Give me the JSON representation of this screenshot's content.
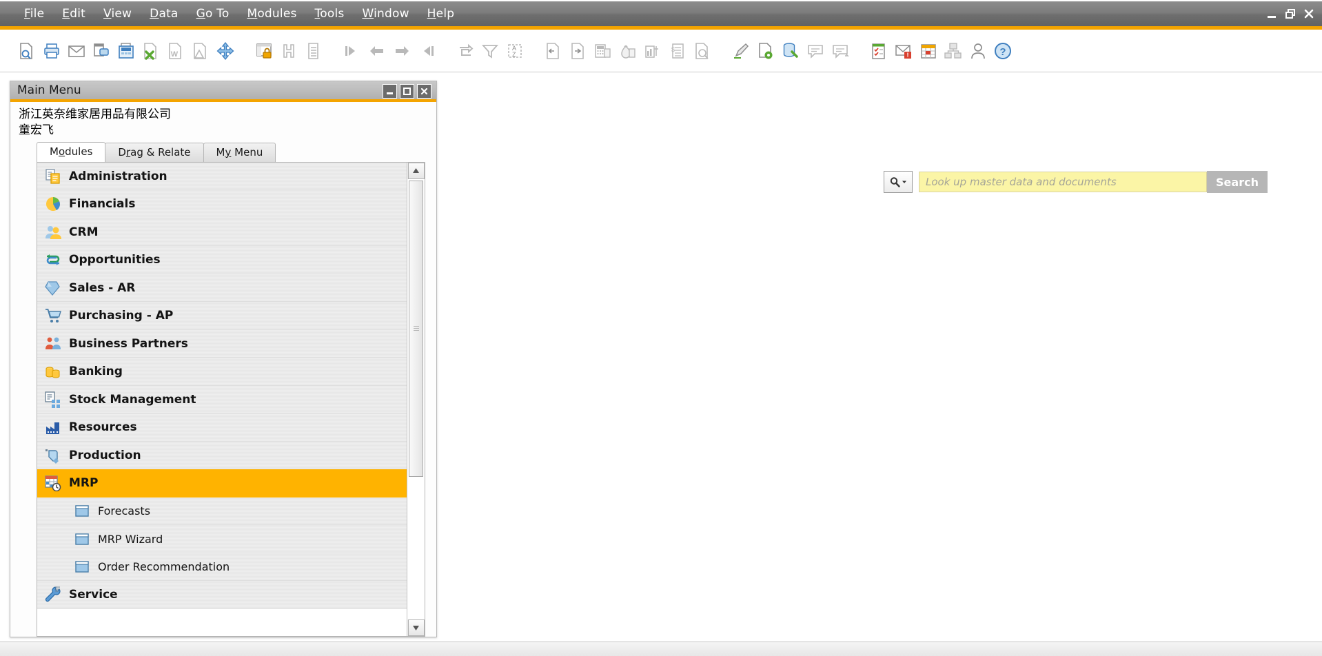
{
  "menubar": {
    "items": [
      {
        "name": "file",
        "pre": "",
        "mn": "F",
        "post": "ile"
      },
      {
        "name": "edit",
        "pre": "",
        "mn": "E",
        "post": "dit"
      },
      {
        "name": "view",
        "pre": "",
        "mn": "V",
        "post": "iew"
      },
      {
        "name": "data",
        "pre": "",
        "mn": "D",
        "post": "ata"
      },
      {
        "name": "goto",
        "pre": "",
        "mn": "G",
        "post": "o To"
      },
      {
        "name": "modules",
        "pre": "",
        "mn": "M",
        "post": "odules"
      },
      {
        "name": "tools",
        "pre": "",
        "mn": "T",
        "post": "ools"
      },
      {
        "name": "window",
        "pre": "",
        "mn": "W",
        "post": "indow"
      },
      {
        "name": "help",
        "pre": "",
        "mn": "H",
        "post": "elp"
      }
    ],
    "window_controls": [
      "minimize",
      "restore",
      "close"
    ],
    "accent_color": "#f4a400"
  },
  "toolbar": {
    "icons": [
      "print-preview-icon",
      "print-icon",
      "email-icon",
      "sms-icon",
      "fax-icon",
      "export-excel-icon",
      "export-word-icon",
      "export-pdf-icon",
      "launch-app-icon",
      "lock-screen-icon",
      "find-icon",
      "list-icon",
      "first-record-icon",
      "previous-record-icon",
      "next-record-icon",
      "last-record-icon",
      "refresh-icon",
      "filter-icon",
      "sort-icon",
      "copy-from-icon",
      "copy-to-icon",
      "calculator-icon",
      "money-bag-icon",
      "balance-report-icon",
      "invoice-icon",
      "query-icon",
      "edit-pencil-icon",
      "new-document-icon",
      "database-tools-icon",
      "message-icon",
      "reply-message-icon",
      "checklist-icon",
      "alerts-icon",
      "calendar-icon",
      "org-chart-icon",
      "user-icon",
      "help-icon"
    ]
  },
  "search": {
    "magnifier_icon": "search-icon",
    "dropdown_icon": "chevron-down-icon",
    "placeholder": "Look up master data and documents",
    "value": "",
    "button_label": "Search"
  },
  "main_menu": {
    "title": "Main Menu",
    "window_buttons": [
      "minimize",
      "maximize",
      "close"
    ],
    "company": "浙江英奈维家居用品有限公司",
    "user": "童宏飞",
    "tabs": [
      {
        "name": "modules",
        "pre": "M",
        "mn": "o",
        "post": "dules",
        "active": true
      },
      {
        "name": "drag-relate",
        "pre": "D",
        "mn": "r",
        "post": "ag & Relate",
        "active": false
      },
      {
        "name": "my-menu",
        "pre": "M",
        "mn": "y",
        "post": " Menu",
        "active": false
      }
    ],
    "items": [
      {
        "label": "Administration",
        "icon": "administration-icon",
        "level": 0,
        "selected": false
      },
      {
        "label": "Financials",
        "icon": "financials-icon",
        "level": 0,
        "selected": false
      },
      {
        "label": "CRM",
        "icon": "crm-icon",
        "level": 0,
        "selected": false
      },
      {
        "label": "Opportunities",
        "icon": "opportunities-icon",
        "level": 0,
        "selected": false
      },
      {
        "label": "Sales - AR",
        "icon": "sales-icon",
        "level": 0,
        "selected": false
      },
      {
        "label": "Purchasing - AP",
        "icon": "purchasing-icon",
        "level": 0,
        "selected": false
      },
      {
        "label": "Business Partners",
        "icon": "business-partners-icon",
        "level": 0,
        "selected": false
      },
      {
        "label": "Banking",
        "icon": "banking-icon",
        "level": 0,
        "selected": false
      },
      {
        "label": "Stock Management",
        "icon": "stock-management-icon",
        "level": 0,
        "selected": false
      },
      {
        "label": "Resources",
        "icon": "resources-icon",
        "level": 0,
        "selected": false
      },
      {
        "label": "Production",
        "icon": "production-icon",
        "level": 0,
        "selected": false
      },
      {
        "label": "MRP",
        "icon": "mrp-icon",
        "level": 0,
        "selected": true
      },
      {
        "label": "Forecasts",
        "icon": "window-icon",
        "level": 1,
        "selected": false
      },
      {
        "label": "MRP Wizard",
        "icon": "window-icon",
        "level": 1,
        "selected": false
      },
      {
        "label": "Order Recommendation",
        "icon": "window-icon",
        "level": 1,
        "selected": false
      },
      {
        "label": "Service",
        "icon": "service-icon",
        "level": 0,
        "selected": false
      }
    ],
    "selection_color": "#ffb300"
  }
}
